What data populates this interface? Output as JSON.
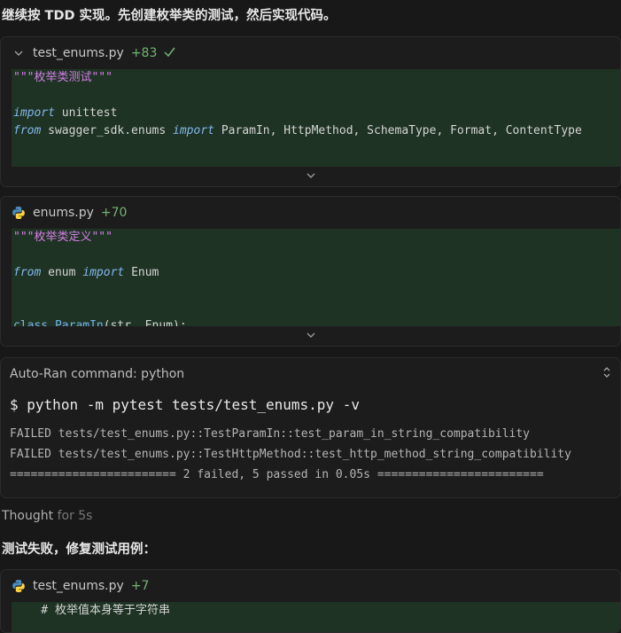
{
  "messages": {
    "intro": "继续按 TDD 实现。先创建枚举类的测试，然后实现代码。",
    "fix": "测试失败，修复测试用例："
  },
  "cards": [
    {
      "filename": "test_enums.py",
      "additions": "+83",
      "lines": [
        {
          "parts": [
            {
              "t": "\"\"\"枚举类测试\"\"\"",
              "c": "str"
            }
          ]
        },
        {
          "parts": []
        },
        {
          "parts": [
            {
              "t": "import",
              "c": "kw"
            },
            {
              "t": " unittest",
              "c": ""
            }
          ]
        },
        {
          "parts": [
            {
              "t": "from",
              "c": "kw"
            },
            {
              "t": " swagger_sdk.enums ",
              "c": ""
            },
            {
              "t": "import",
              "c": "kw"
            },
            {
              "t": " ParamIn, HttpMethod, SchemaType, Format, ContentType",
              "c": ""
            }
          ]
        }
      ]
    },
    {
      "filename": "enums.py",
      "additions": "+70",
      "lines": [
        {
          "parts": [
            {
              "t": "\"\"\"枚举类定义\"\"\"",
              "c": "str"
            }
          ]
        },
        {
          "parts": []
        },
        {
          "parts": [
            {
              "t": "from",
              "c": "kw"
            },
            {
              "t": " enum ",
              "c": ""
            },
            {
              "t": "import",
              "c": "kw"
            },
            {
              "t": " Enum",
              "c": ""
            }
          ]
        },
        {
          "parts": []
        },
        {
          "parts": []
        },
        {
          "parts": [
            {
              "t": "class",
              "c": "cls-kw"
            },
            {
              "t": " ",
              "c": ""
            },
            {
              "t": "ParamIn",
              "c": "cls-name"
            },
            {
              "t": "(str, Enum):",
              "c": ""
            }
          ]
        }
      ]
    },
    {
      "filename": "test_enums.py",
      "additions": "+7",
      "lines": [
        {
          "parts": [
            {
              "t": "    # 枚举值本身等于字符串",
              "c": ""
            }
          ]
        }
      ]
    }
  ],
  "terminal": {
    "title": "Auto-Ran command: python",
    "prompt_symbol": "$",
    "command": "python -m pytest tests/test_enums.py -v",
    "output": [
      "FAILED tests/test_enums.py::TestParamIn::test_param_in_string_compatibility",
      "FAILED tests/test_enums.py::TestHttpMethod::test_http_method_string_compatibility",
      "======================== 2 failed, 5 passed in 0.05s ========================"
    ]
  },
  "thought": {
    "label": "Thought",
    "duration": "for 5s"
  },
  "icons": {
    "collapse": "chevron-down-icon",
    "expand": "chevron-down-icon",
    "done": "check-icon",
    "python": "python-icon",
    "toggle": "chevron-updown-icon"
  },
  "colors": {
    "added_background": "#1e3323",
    "additions": "#71b571",
    "string": "#d67ee8",
    "keyword": "#83b7ee"
  }
}
